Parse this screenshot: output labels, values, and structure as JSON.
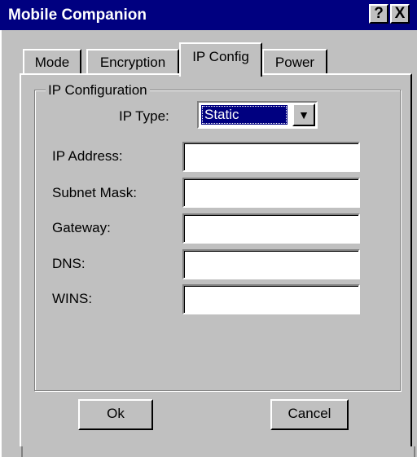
{
  "window": {
    "title": "Mobile Companion",
    "help_label": "?",
    "close_label": "X"
  },
  "tabs": [
    {
      "label": "Mode",
      "selected": false
    },
    {
      "label": "Encryption",
      "selected": false
    },
    {
      "label": "IP Config",
      "selected": true
    },
    {
      "label": "Power",
      "selected": false
    }
  ],
  "group": {
    "title": "IP Configuration",
    "ip_type_label": "IP Type:",
    "ip_type_value": "Static",
    "fields": [
      {
        "label": "IP Address:",
        "value": ""
      },
      {
        "label": "Subnet Mask:",
        "value": ""
      },
      {
        "label": "Gateway:",
        "value": ""
      },
      {
        "label": "DNS:",
        "value": ""
      },
      {
        "label": "WINS:",
        "value": ""
      }
    ]
  },
  "buttons": {
    "ok_label": "Ok",
    "cancel_label": "Cancel"
  },
  "colors": {
    "titlebar": "#000080",
    "face": "#c0c0c0",
    "selection": "#000080"
  }
}
